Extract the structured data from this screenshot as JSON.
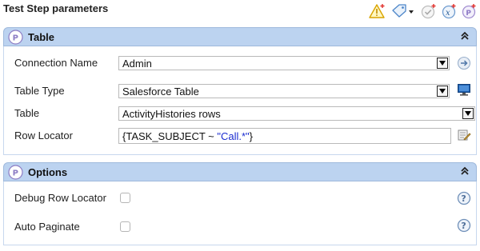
{
  "panel": {
    "title": "Test Step parameters"
  },
  "toolbar": {
    "icons": [
      "warning-add-icon",
      "tag-dropdown-icon",
      "check-add-icon",
      "step-formula-icon",
      "provar-add-icon"
    ]
  },
  "sections": {
    "table": {
      "title": "Table",
      "fields": {
        "connection_name": {
          "label": "Connection Name",
          "value": "Admin"
        },
        "table_type": {
          "label": "Table Type",
          "value": "Salesforce Table"
        },
        "table": {
          "label": "Table",
          "value": "ActivityHistories rows"
        },
        "row_locator": {
          "label": "Row Locator",
          "prefix": "{TASK_SUBJECT ~ ",
          "string": "\"Call.*\"",
          "suffix": "}"
        }
      }
    },
    "options": {
      "title": "Options",
      "fields": {
        "debug_row_locator": {
          "label": "Debug Row Locator",
          "checked": false
        },
        "auto_paginate": {
          "label": "Auto Paginate",
          "checked": false
        }
      }
    }
  },
  "colors": {
    "section_header_bg": "#bcd3f0",
    "expression_string": "#1a2cd0"
  }
}
